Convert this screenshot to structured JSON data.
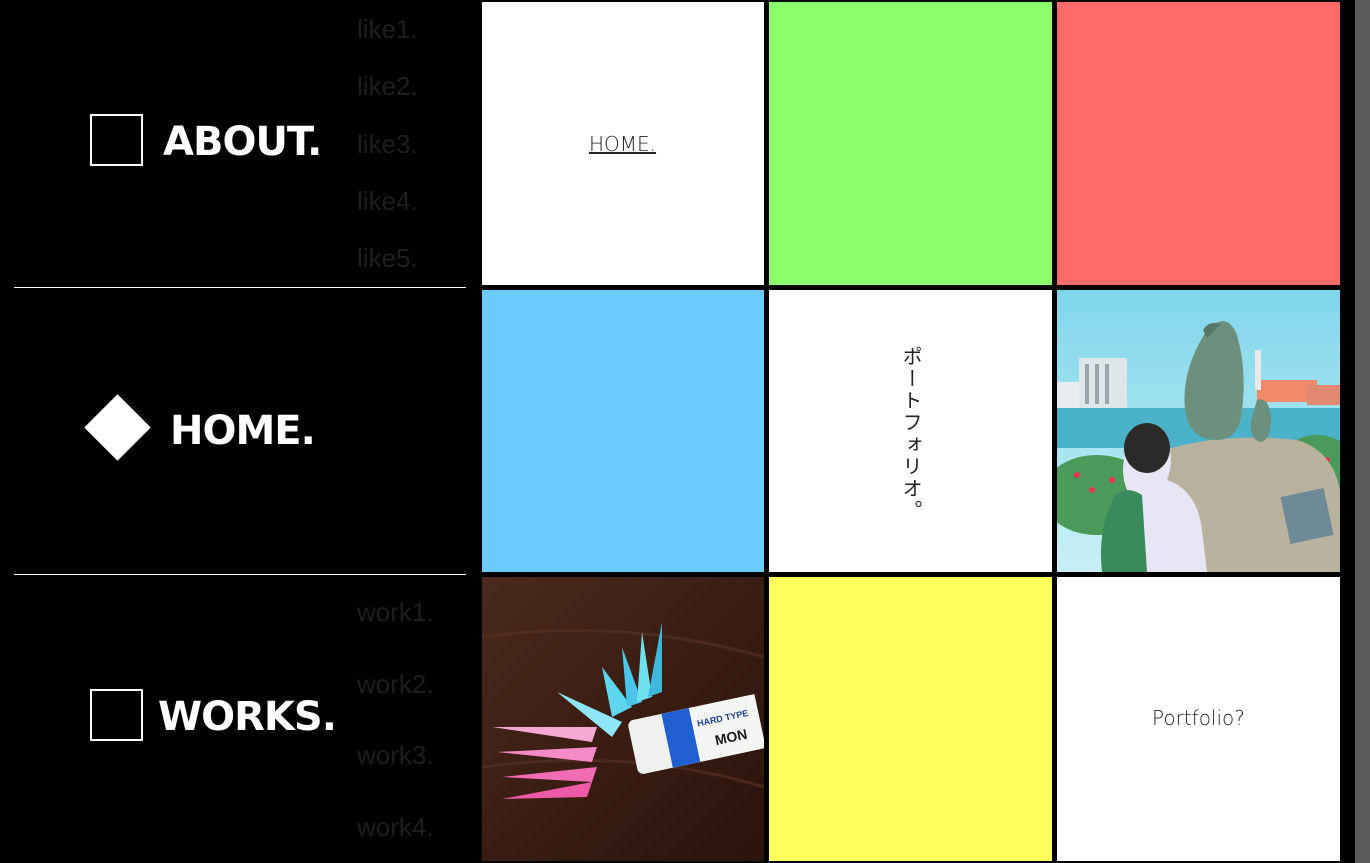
{
  "nav": {
    "about": {
      "label": "ABOUT.",
      "sub_items": [
        "like1.",
        "like2.",
        "like3.",
        "like4.",
        "like5."
      ]
    },
    "home": {
      "label": "HOME."
    },
    "works": {
      "label": "WORKS.",
      "sub_items": [
        "work1.",
        "work2.",
        "work3.",
        "work4."
      ]
    }
  },
  "tiles": {
    "home_link": "HOME.",
    "vertical_text": "ポートフォリオ。",
    "portfolio_q": "Portfolio?",
    "colors": {
      "green": "#8cff6b",
      "red": "#ff6a6a",
      "blue": "#6bccfc",
      "yellow": "#ffff5c",
      "white": "#ffffff"
    }
  },
  "photos": {
    "penguin_photo": {
      "icon": "penguin-statue-photo"
    },
    "origami_photo": {
      "icon": "origami-cranes-eraser-photo",
      "eraser_text": "HARD TYPE",
      "eraser_brand": "MON"
    }
  }
}
